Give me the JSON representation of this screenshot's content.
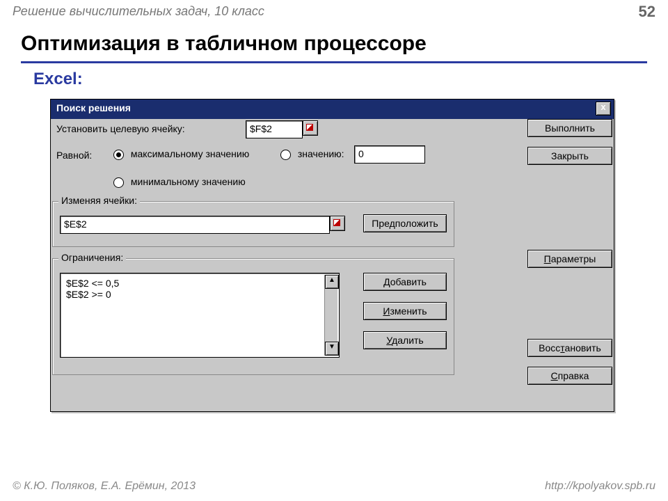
{
  "slide": {
    "topline": "Решение вычислительных задач, 10 класс",
    "page_no": "52",
    "title": "Оптимизация в табличном процессоре",
    "excel_label": "Excel:",
    "footer_left": "© К.Ю. Поляков, Е.А. Ерёмин, 2013",
    "footer_right": "http://kpolyakov.spb.ru"
  },
  "dlg": {
    "title": "Поиск решения",
    "close": "x",
    "set_target_label": "Установить целевую ячейку:",
    "target_cell": "$F$2",
    "equal_label": "Равной:",
    "opt_max": "максимальному значению",
    "opt_val": "значению:",
    "val_input": "0",
    "opt_min": "минимальному значению",
    "changing_legend": "Изменяя ячейки:",
    "changing_value": "$E$2",
    "guess_btn": "Предположить",
    "constraints_legend": "Ограничения:",
    "constraints_text": "$E$2 <= 0,5\n$E$2 >= 0",
    "add_btn": "Добавить",
    "change_btn": "Изменить",
    "delete_btn": "Удалить",
    "run_btn": "Выполнить",
    "close_btn": "Закрыть",
    "params_btn": "Параметры",
    "restore_btn": "Восстановить",
    "help_btn": "Справка"
  }
}
